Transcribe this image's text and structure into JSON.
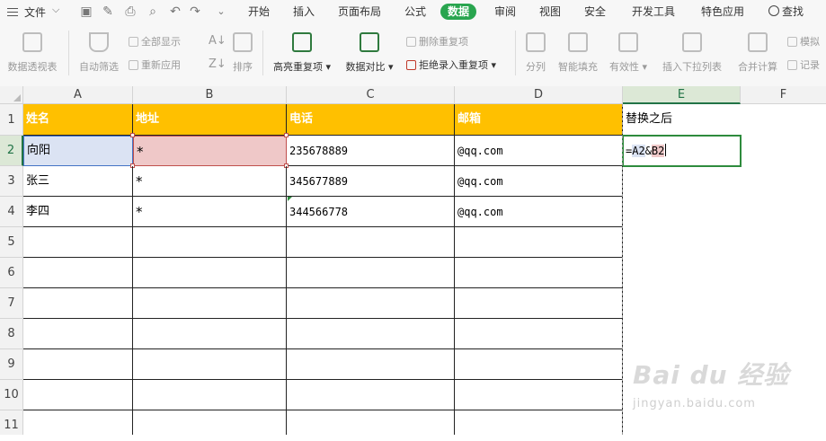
{
  "menu": {
    "file_label": "文件",
    "tabs": [
      "开始",
      "插入",
      "页面布局",
      "公式",
      "数据",
      "审阅",
      "视图",
      "安全",
      "开发工具",
      "特色应用"
    ],
    "active_tab": "数据",
    "search_label": "查找"
  },
  "ribbon": {
    "pivot": "数据透视表",
    "autofilter": "自动筛选",
    "show_all": "全部显示",
    "reapply": "重新应用",
    "sort": "排序",
    "highlight_dup": "高亮重复项",
    "compare": "数据对比",
    "remove_dup": "删除重复项",
    "reject_dup": "拒绝录入重复项",
    "split": "分列",
    "smart_fill": "智能填充",
    "validity": "有效性",
    "dropdown": "插入下拉列表",
    "merge_calc": "合并计算",
    "simulate": "模拟",
    "record": "记录"
  },
  "sheet": {
    "columns": [
      "A",
      "B",
      "C",
      "D",
      "E",
      "F"
    ],
    "rows": [
      "1",
      "2",
      "3",
      "4",
      "5",
      "6",
      "7",
      "8",
      "9",
      "10",
      "11"
    ],
    "header_row": [
      "姓名",
      "地址",
      "电话",
      "邮箱"
    ],
    "e1": "替换之后",
    "data": [
      [
        "向阳",
        "*",
        "235678889",
        "@qq.com"
      ],
      [
        "张三",
        "*",
        "345677889",
        "@qq.com"
      ],
      [
        "李四",
        "*",
        "344566778",
        "@qq.com"
      ]
    ],
    "formula": {
      "prefix": "=",
      "ref1": "A2",
      "op": "&",
      "ref2": "B2"
    }
  },
  "watermark": {
    "brand": "Bai du 经验",
    "url": "jingyan.baidu.com"
  },
  "colors": {
    "header_fill": "#ffc000",
    "active_tab": "#29a54f",
    "ref_a": "#dbe3f3",
    "ref_b": "#efc8c8",
    "edit_border": "#2e8b3d"
  }
}
